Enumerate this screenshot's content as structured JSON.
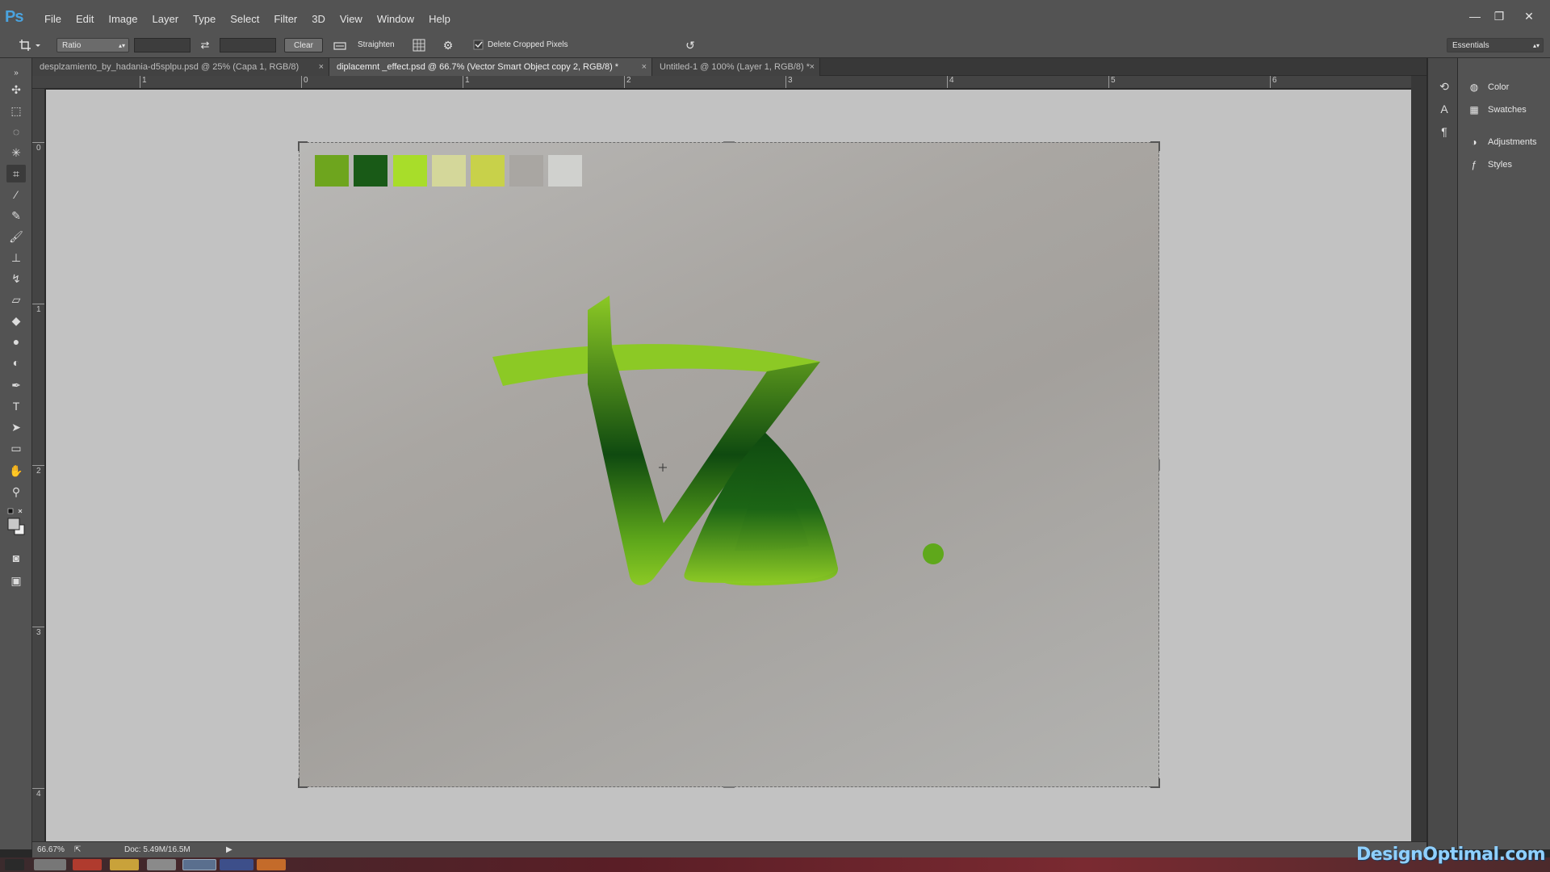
{
  "app": {
    "logo": "Ps"
  },
  "menu": [
    "File",
    "Edit",
    "Image",
    "Layer",
    "Type",
    "Select",
    "Filter",
    "3D",
    "View",
    "Window",
    "Help"
  ],
  "window_controls": {
    "minimize": "—",
    "restore": "❐",
    "close": "✕"
  },
  "options": {
    "ratio_select": "Ratio",
    "ratio_width": "",
    "ratio_height": "",
    "clear_label": "Clear",
    "straighten_label": "Straighten",
    "delete_cropped_label": "Delete Cropped Pixels",
    "delete_cropped_checked": true,
    "workspace": "Essentials"
  },
  "tabs": [
    {
      "label": "desplzamiento_by_hadania-d5splpu.psd @ 25% (Capa 1, RGB/8)",
      "active": false
    },
    {
      "label": "diplacemnt _effect.psd @ 66.7% (Vector Smart Object copy 2, RGB/8) *",
      "active": true
    },
    {
      "label": "Untitled-1 @ 100% (Layer 1, RGB/8) *",
      "active": false
    }
  ],
  "tab_close": "×",
  "ruler_top": [
    "1",
    "0",
    "1",
    "2",
    "3",
    "4",
    "5",
    "6"
  ],
  "ruler_left": [
    "0",
    "1",
    "2",
    "3",
    "4"
  ],
  "swatches": [
    "#6ea51e",
    "#195a17",
    "#a8dd2a",
    "#d4d79a",
    "#c8d14a",
    "#a9a6a2",
    "#d0d1ce"
  ],
  "logo_colors": {
    "light": "#8cc925",
    "mid": "#5fa81b",
    "dark": "#0f4a10"
  },
  "panels": [
    {
      "label": "Color",
      "icon": "color-icon"
    },
    {
      "label": "Swatches",
      "icon": "swatches-icon"
    },
    {
      "label": "Adjustments",
      "icon": "adjustments-icon"
    },
    {
      "label": "Styles",
      "icon": "styles-icon"
    }
  ],
  "status": {
    "zoom": "66.67%",
    "doc": "Doc: 5.49M/16.5M"
  },
  "watermark": "DesignOptimal.com"
}
